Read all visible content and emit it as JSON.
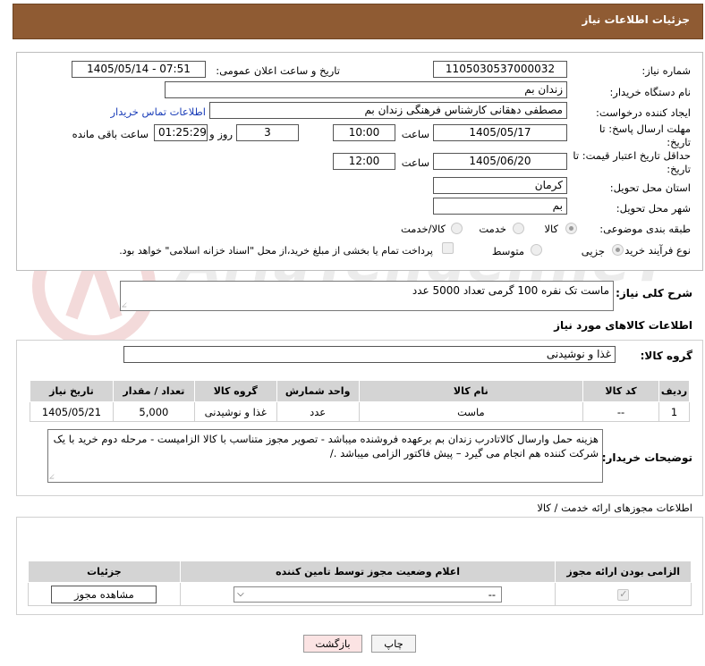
{
  "header": {
    "title": "جزئیات اطلاعات نیاز"
  },
  "form": {
    "need_number": {
      "label": "شماره نیاز:",
      "value": "1105030537000032"
    },
    "announce": {
      "label": "تاریخ و ساعت اعلان عمومی:",
      "value": "1405/05/14 - 07:51"
    },
    "buyer_org": {
      "label": "نام دستگاه خریدار:",
      "value": "زندان بم"
    },
    "creator": {
      "label": "ایجاد کننده درخواست:",
      "value": "مصطفی دهقانی کارشناس فرهنگی زندان بم",
      "contact_link": "اطلاعات تماس خریدار"
    },
    "reply_deadline": {
      "label": "مهلت ارسال پاسخ: تا تاریخ:",
      "date": "1405/05/17",
      "time_label": "ساعت",
      "time": "10:00",
      "days": "3",
      "days_label": "روز و",
      "remaining": "01:25:29",
      "remaining_label": "ساعت باقی مانده"
    },
    "price_deadline": {
      "label": "حداقل تاریخ اعتبار قیمت: تا تاریخ:",
      "date": "1405/06/20",
      "time_label": "ساعت",
      "time": "12:00"
    },
    "province": {
      "label": "استان محل تحویل:",
      "value": "کرمان"
    },
    "city": {
      "label": "شهر محل تحویل:",
      "value": "بم"
    },
    "category": {
      "label": "طبقه بندی موضوعی:",
      "options": [
        "کالا",
        "خدمت",
        "کالا/خدمت"
      ],
      "selected": "کالا"
    },
    "purchase_type": {
      "label": "نوع فرآیند خرید :",
      "options": [
        "جزیی",
        "متوسط"
      ],
      "selected": "جزیی",
      "treasury_note": "پرداخت تمام یا بخشی از مبلغ خرید،از محل \"اسناد خزانه اسلامی\" خواهد بود."
    }
  },
  "description": {
    "label": "شرح کلی نیاز:",
    "value": "ماست تک نفره 100 گرمی تعداد 5000 عدد"
  },
  "goods": {
    "title": "اطلاعات کالاهای مورد نیاز",
    "group_label": "گروه کالا:",
    "group_value": "غذا و نوشیدنی",
    "columns": [
      "ردیف",
      "کد کالا",
      "نام کالا",
      "واحد شمارش",
      "گروه کالا",
      "تعداد / مقدار",
      "تاریخ نیاز"
    ],
    "rows": [
      {
        "row": "1",
        "code": "--",
        "name": "ماست",
        "unit": "عدد",
        "group": "غذا و نوشیدنی",
        "qty": "5,000",
        "date": "1405/05/21"
      }
    ]
  },
  "buyer_notes": {
    "label": "توضیحات خریدار:",
    "value": "هزینه حمل وارسال کالاتادرب زندان بم برعهده فروشنده میباشد - تصویر مجوز متناسب با کالا الزامیست - مرحله دوم خرید با یک شرکت کننده هم انجام می گیرد – پیش فاکتور الزامی میباشد ./"
  },
  "licenses": {
    "title": "اطلاعات مجوزهای ارائه خدمت / کالا",
    "columns": [
      "الزامی بودن ارائه مجوز",
      "اعلام وضعیت مجوز توسط تامین کننده",
      "جزئیات"
    ],
    "select_value": "--",
    "view_button": "مشاهده مجوز"
  },
  "footer": {
    "print_label": "چاپ",
    "back_label": "بازگشت"
  },
  "colors": {
    "header_bg": "#8f5b33",
    "back_btn_bg": "#fbe3e3"
  }
}
